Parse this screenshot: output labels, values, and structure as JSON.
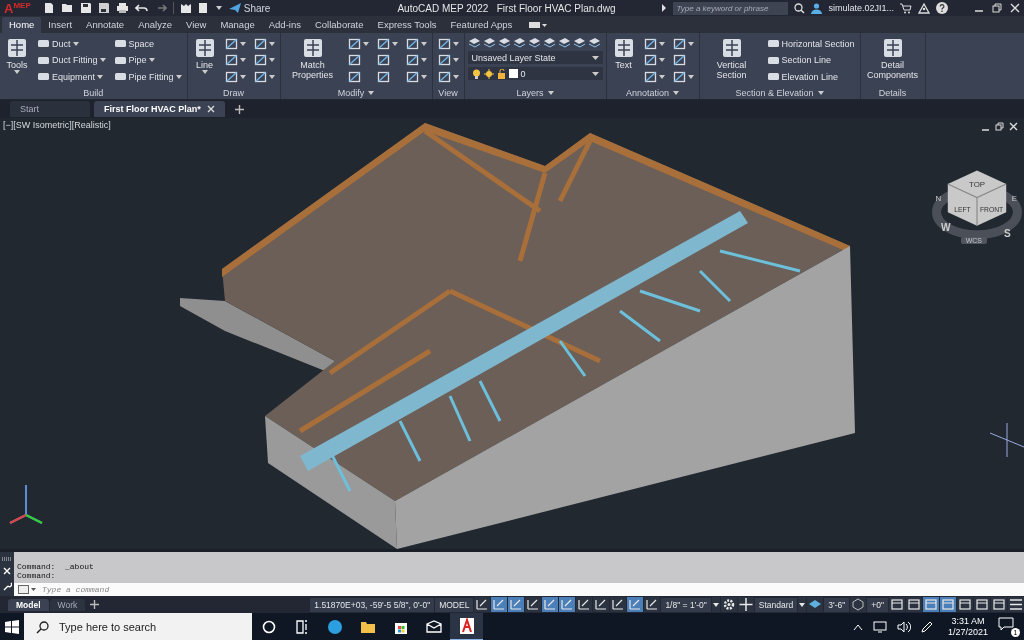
{
  "app_button": {
    "letter": "A",
    "edition": "MEP"
  },
  "quick_access": {
    "share": "Share"
  },
  "title_bar": {
    "app": "AutoCAD MEP 2022",
    "document": "First Floor HVAC Plan.dwg",
    "search_placeholder": "Type a keyword or phrase",
    "user": "simulate.02JI1..."
  },
  "ribbon_tabs": [
    {
      "label": "Home",
      "selected": true
    },
    {
      "label": "Insert",
      "selected": false
    },
    {
      "label": "Annotate",
      "selected": false
    },
    {
      "label": "Analyze",
      "selected": false
    },
    {
      "label": "View",
      "selected": false
    },
    {
      "label": "Manage",
      "selected": false
    },
    {
      "label": "Add-ins",
      "selected": false
    },
    {
      "label": "Collaborate",
      "selected": false
    },
    {
      "label": "Express Tools",
      "selected": false
    },
    {
      "label": "Featured Apps",
      "selected": false
    }
  ],
  "ribbon_panels": [
    {
      "kind": "tools",
      "title": "Build",
      "menu": false,
      "columns": [
        [
          {
            "kind": "large",
            "label": "Tools",
            "dropdown": true
          }
        ],
        [
          {
            "kind": "small",
            "label": "Duct",
            "dropdown": true
          },
          {
            "kind": "small",
            "label": "Duct Fitting",
            "dropdown": true
          },
          {
            "kind": "small",
            "label": "Equipment",
            "dropdown": true
          }
        ],
        [
          {
            "kind": "small",
            "label": "Space",
            "dropdown": false
          },
          {
            "kind": "small",
            "label": "Pipe",
            "dropdown": true
          },
          {
            "kind": "small",
            "label": "Pipe Fitting",
            "dropdown": true
          }
        ]
      ]
    },
    {
      "kind": "tools",
      "title": "Draw",
      "menu": false,
      "columns": [
        [
          {
            "kind": "large",
            "label": "Line",
            "dropdown": true
          }
        ],
        [
          {
            "kind": "icon",
            "dropdown": true
          },
          {
            "kind": "icon",
            "dropdown": true
          },
          {
            "kind": "icon",
            "dropdown": true
          }
        ],
        [
          {
            "kind": "icon",
            "dropdown": true
          },
          {
            "kind": "icon",
            "dropdown": true
          },
          {
            "kind": "icon",
            "dropdown": true
          }
        ]
      ]
    },
    {
      "kind": "tools",
      "title": "Modify",
      "menu": true,
      "columns": [
        [
          {
            "kind": "large",
            "label": "Match Properties",
            "dropdown": false
          }
        ],
        [
          {
            "kind": "icon",
            "dropdown": true
          },
          {
            "kind": "icon",
            "dropdown": false
          },
          {
            "kind": "icon",
            "dropdown": false
          }
        ],
        [
          {
            "kind": "icon",
            "dropdown": true
          },
          {
            "kind": "icon",
            "dropdown": false
          },
          {
            "kind": "icon",
            "dropdown": false
          }
        ],
        [
          {
            "kind": "icon",
            "dropdown": true
          },
          {
            "kind": "icon",
            "dropdown": true
          },
          {
            "kind": "icon",
            "dropdown": true
          }
        ]
      ]
    },
    {
      "kind": "tools",
      "title": "View",
      "menu": false,
      "columns": [
        [
          {
            "kind": "icon",
            "dropdown": true
          },
          {
            "kind": "icon",
            "dropdown": true
          },
          {
            "kind": "icon",
            "dropdown": true
          }
        ]
      ]
    },
    {
      "kind": "layers",
      "title": "Layers",
      "menu": true,
      "layer_state": "Unsaved Layer State",
      "current_layer": "0"
    },
    {
      "kind": "tools",
      "title": "Annotation",
      "menu": true,
      "columns": [
        [
          {
            "kind": "large",
            "label": "Text",
            "dropdown": false
          }
        ],
        [
          {
            "kind": "icon",
            "dropdown": true
          },
          {
            "kind": "icon",
            "dropdown": true
          },
          {
            "kind": "icon",
            "dropdown": true
          }
        ],
        [
          {
            "kind": "icon",
            "dropdown": true
          },
          {
            "kind": "icon",
            "dropdown": false
          },
          {
            "kind": "icon",
            "dropdown": true
          }
        ]
      ]
    },
    {
      "kind": "tools",
      "title": "Section & Elevation",
      "menu": true,
      "columns": [
        [
          {
            "kind": "large",
            "label": "Vertical Section",
            "dropdown": false
          }
        ],
        [
          {
            "kind": "small",
            "label": "Horizontal Section",
            "dropdown": false
          },
          {
            "kind": "small",
            "label": "Section Line",
            "dropdown": false
          },
          {
            "kind": "small",
            "label": "Elevation Line",
            "dropdown": false
          }
        ]
      ]
    },
    {
      "kind": "tools",
      "title": "Details",
      "menu": false,
      "columns": [
        [
          {
            "kind": "large",
            "label": "Detail Components",
            "dropdown": false
          }
        ]
      ]
    }
  ],
  "document_tabs": [
    {
      "label": "Start",
      "selected": false,
      "closable": false
    },
    {
      "label": "First Floor HVAC Plan*",
      "selected": true,
      "closable": true
    }
  ],
  "viewport": {
    "label": "[−][SW Isometric][Realistic]",
    "view_cube": {
      "top": "TOP",
      "left": "LEFT",
      "front": "FRONT",
      "north": "N",
      "east": "E",
      "south": "S",
      "west": "W",
      "ucs": "WCS"
    }
  },
  "command_line": {
    "history": [
      "Command:  _about",
      "Command:"
    ],
    "placeholder": "Type a command"
  },
  "layout_tabs": [
    {
      "label": "Model",
      "selected": true
    },
    {
      "label": "Work",
      "selected": false
    }
  ],
  "status_bar": {
    "coordinates": "1.51870E+03, -59'-5 5/8\", 0'-0\"",
    "space": "MODEL",
    "scale": "1/8\" = 1'-0\"",
    "style": "Standard",
    "cut_plane": "3'-6\"",
    "elevation": "+0\"",
    "toggles": [
      {
        "on": false
      },
      {
        "on": true
      },
      {
        "on": true
      },
      {
        "on": false
      },
      {
        "on": true
      },
      {
        "on": true
      },
      {
        "on": false
      },
      {
        "on": false
      },
      {
        "on": false
      },
      {
        "on": true
      },
      {
        "on": false
      }
    ],
    "tools": [
      {
        "on": false
      },
      {
        "on": false
      },
      {
        "on": true
      },
      {
        "on": true
      },
      {
        "on": false
      },
      {
        "on": false
      },
      {
        "on": false
      }
    ]
  },
  "taskbar": {
    "search_placeholder": "Type here to search",
    "apps": [
      {
        "kind": "cortana",
        "active": false
      },
      {
        "kind": "taskview",
        "active": false
      },
      {
        "kind": "edge",
        "active": false
      },
      {
        "kind": "explorer",
        "active": false
      },
      {
        "kind": "store",
        "active": false
      },
      {
        "kind": "mail",
        "active": false
      },
      {
        "kind": "autocad",
        "active": true
      }
    ],
    "time": "3:31 AM",
    "date": "1/27/2021",
    "notifications": "1"
  }
}
